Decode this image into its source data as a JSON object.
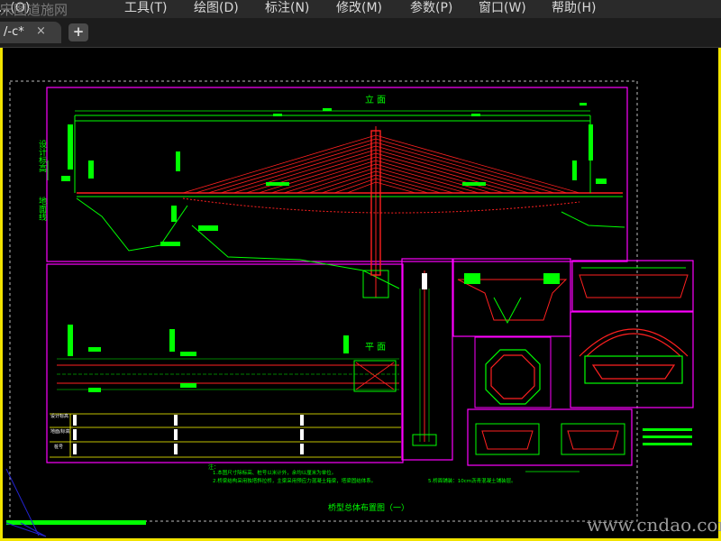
{
  "menu": [
    "...(O)",
    "工具(T)",
    "绘图(D)",
    "标注(N)",
    "修改(M)",
    "参数(P)",
    "窗口(W)",
    "帮助(H)"
  ],
  "watermark_logo": "宋图道施网",
  "tab": {
    "title": "/-c*",
    "close": "×",
    "new": "+"
  },
  "drawing": {
    "sheet_title": "桥型总体布置图（一）",
    "view_elevation": "立 面",
    "view_plan": "平 面",
    "table_rows": [
      "设计标高",
      "地面/标高",
      "桩号"
    ],
    "notes": [
      "注：",
      "1.本图尺寸除标高、桩号以米计外，余均以厘米为单位。",
      "2.桥梁结构采用独塔斜拉桥，主梁采用预应力混凝土箱梁，塔梁固结体系。",
      "5.桥面铺装：10cm沥青混凝土铺装层。"
    ],
    "side_labels": [
      "设计标高",
      "地面线"
    ]
  },
  "watermark": "www.cndao.com",
  "colors": {
    "frame": "#f2e400",
    "magenta": "#ff00ff",
    "green": "#00ff00",
    "red": "#ff2020",
    "white": "#ffffff"
  }
}
